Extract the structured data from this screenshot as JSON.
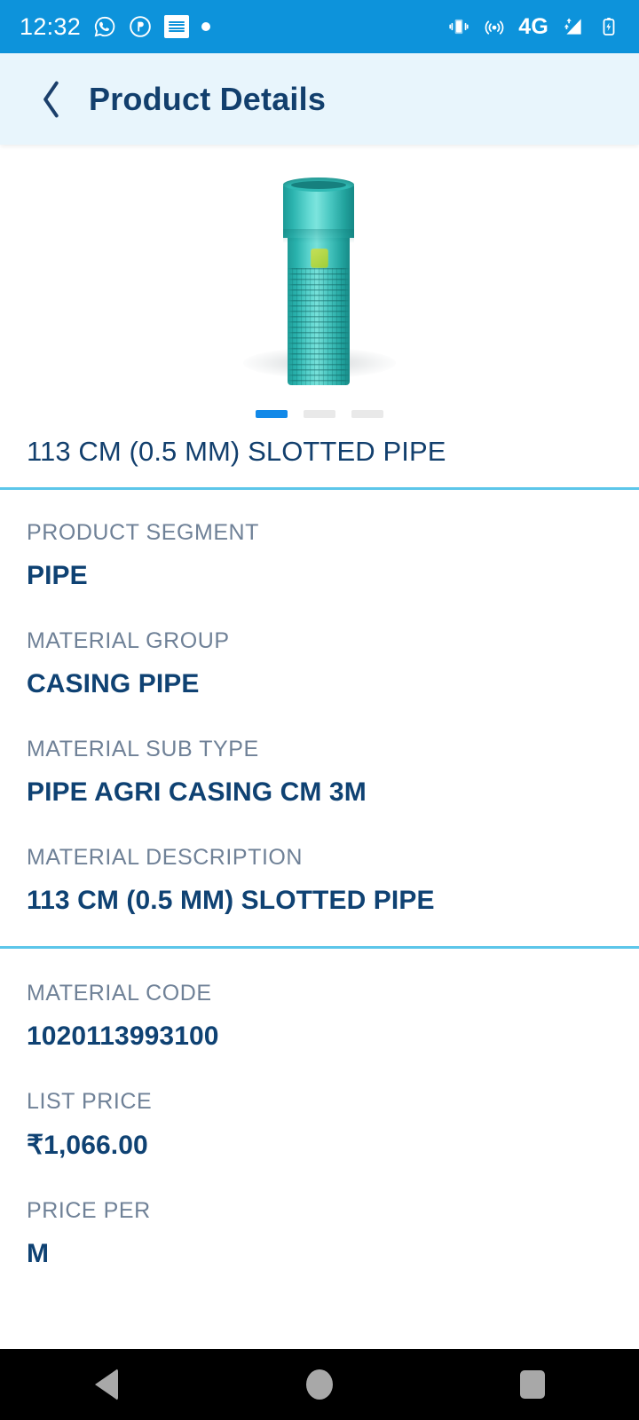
{
  "status_bar": {
    "time": "12:32",
    "network": "4G",
    "left_icons": [
      "whatsapp-icon",
      "app-circle-icon",
      "notification-card-icon",
      "dot-indicator-icon"
    ],
    "right_icons": [
      "vibrate-icon",
      "hotspot-icon",
      "network-4g-label",
      "signal-bars-icon",
      "battery-charging-icon"
    ],
    "background": "#0d93db"
  },
  "app_bar": {
    "back_label": "back",
    "title": "Product Details",
    "background": "#e8f5fc",
    "title_color": "#123f6d"
  },
  "gallery": {
    "product_image_alt": "113 CM (0.5 MM) SLOTTED PIPE",
    "dots_total": 3,
    "active_dot_index": 0,
    "active_color": "#1289e8",
    "inactive_color": "#e9e9e9"
  },
  "product": {
    "title": "113 CM (0.5 MM) SLOTTED PIPE"
  },
  "specs": [
    {
      "label": "PRODUCT SEGMENT",
      "value": "PIPE"
    },
    {
      "label": "MATERIAL GROUP",
      "value": "CASING PIPE"
    },
    {
      "label": "MATERIAL SUB TYPE",
      "value": "PIPE AGRI CASING CM 3M"
    },
    {
      "label": "MATERIAL DESCRIPTION",
      "value": "113 CM (0.5 MM) SLOTTED PIPE"
    }
  ],
  "pricing": [
    {
      "label": "MATERIAL CODE",
      "value": "1020113993100"
    },
    {
      "label": "LIST PRICE",
      "value": "₹1,066.00"
    },
    {
      "label": "PRICE PER",
      "value": "M"
    }
  ],
  "colors": {
    "accent_blue": "#0d93db",
    "divider_cyan": "#5cc6ea",
    "label_gray": "#6f8197",
    "value_navy": "#0f4273"
  },
  "nav_bar": {
    "buttons": [
      "back",
      "home",
      "recents"
    ],
    "background": "#000000"
  }
}
